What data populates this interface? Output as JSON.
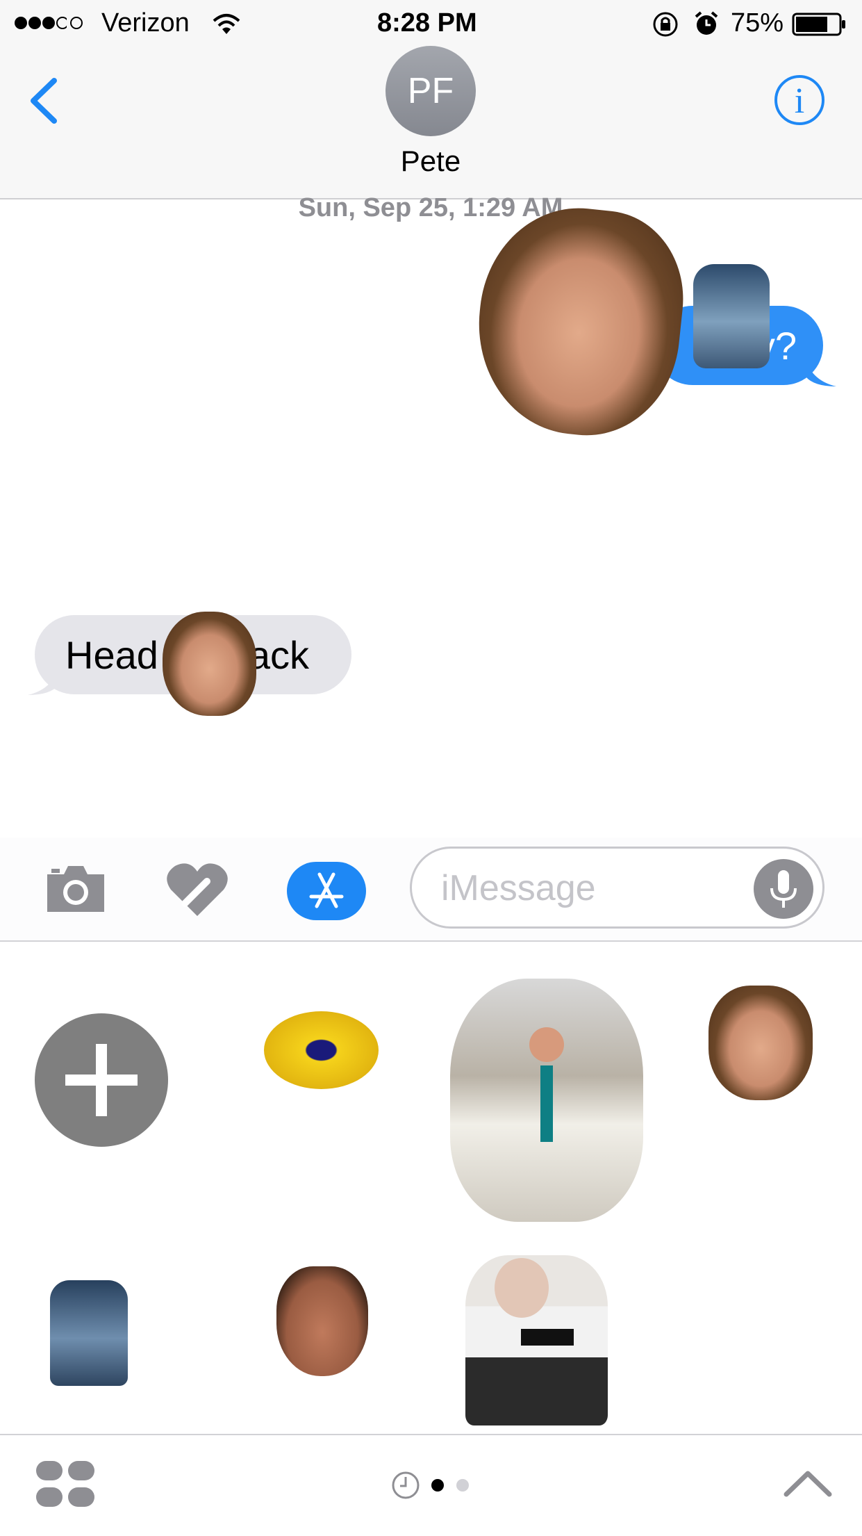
{
  "status_bar": {
    "carrier": "Verizon",
    "time": "8:28 PM",
    "battery": "75%",
    "battery_level": 0.75
  },
  "header": {
    "avatar_initials": "PF",
    "contact_name": "Pete"
  },
  "conversation": {
    "timestamp": "Sun, Sep 25, 1:29 AM",
    "sent_message_visible": "t        y?",
    "received_message_start": "Head",
    "received_message_end": "ack"
  },
  "compose": {
    "placeholder": "iMessage"
  },
  "stickers": [
    {
      "name": "long-haired-face-sticker"
    },
    {
      "name": "water-jug-sticker"
    },
    {
      "name": "pineapple-slice-sticker"
    },
    {
      "name": "man-in-white-suit-sticker"
    },
    {
      "name": "long-haired-face-sticker"
    },
    {
      "name": "water-jug-face-sticker"
    },
    {
      "name": "short-haired-face-sticker"
    },
    {
      "name": "grandma-with-gun-sticker"
    }
  ],
  "colors": {
    "ios_blue": "#1e88f5",
    "sent_bubble": "#2f90f7",
    "received_bubble": "#e5e5ea",
    "gray_icon": "#8e8e93"
  },
  "icons": [
    "back-chevron-icon",
    "info-icon",
    "camera-icon",
    "digital-touch-icon",
    "appstore-icon",
    "microphone-icon",
    "plus-icon",
    "app-drawer-icon",
    "recents-clock-icon",
    "expand-chevron-icon"
  ],
  "page_indicator": {
    "pages": 2,
    "current": 1
  }
}
